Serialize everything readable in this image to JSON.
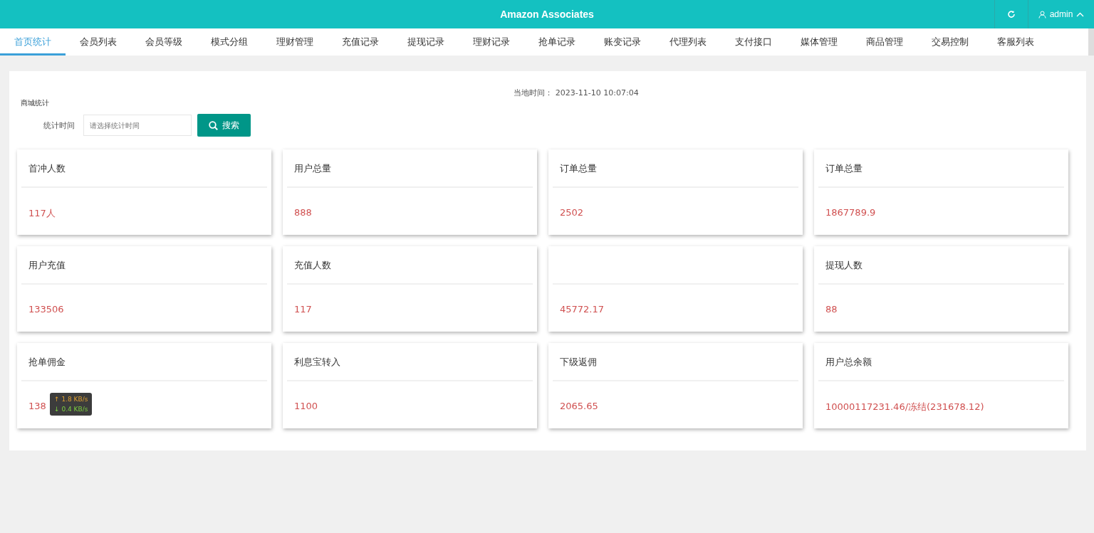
{
  "header": {
    "title": "Amazon Associates",
    "user": "admin"
  },
  "tabs": [
    {
      "label": "首页统计",
      "selected": true
    },
    {
      "label": "会员列表",
      "selected": false
    },
    {
      "label": "会员等级",
      "selected": false
    },
    {
      "label": "模式分组",
      "selected": false
    },
    {
      "label": "理财管理",
      "selected": false
    },
    {
      "label": "充值记录",
      "selected": false
    },
    {
      "label": "提现记录",
      "selected": false
    },
    {
      "label": "理财记录",
      "selected": false
    },
    {
      "label": "抢单记录",
      "selected": false
    },
    {
      "label": "账变记录",
      "selected": false
    },
    {
      "label": "代理列表",
      "selected": false
    },
    {
      "label": "支付接口",
      "selected": false
    },
    {
      "label": "媒体管理",
      "selected": false
    },
    {
      "label": "商品管理",
      "selected": false
    },
    {
      "label": "交易控制",
      "selected": false
    },
    {
      "label": "客服列表",
      "selected": false
    }
  ],
  "local_time": {
    "label": "当地时间：",
    "value": "2023-11-10 10:07:04"
  },
  "section_title": "商城统计",
  "filter": {
    "label": "统计时间",
    "placeholder": "请选择统计时间",
    "button": "搜索"
  },
  "cards": [
    {
      "title": "首冲人数",
      "value": "117人"
    },
    {
      "title": "用户总量",
      "value": "888"
    },
    {
      "title": "订单总量",
      "value": "2502"
    },
    {
      "title": "订单总量",
      "value": "1867789.9"
    },
    {
      "title": "用户充值",
      "value": "133506"
    },
    {
      "title": "充值人数",
      "value": "117"
    },
    {
      "value": "45772.17"
    },
    {
      "title": "提现人数",
      "value": "88"
    },
    {
      "title": "抢单佣金",
      "value": "138"
    },
    {
      "title": "利息宝转入",
      "value": "1100"
    },
    {
      "title": "下级返佣",
      "value": "2065.65"
    },
    {
      "title": "用户总余额",
      "value": "10000117231.46/冻结(231678.12)"
    }
  ],
  "speed_overlay": {
    "upload": "↑ 1.8 KB/s",
    "download": "↓ 0.4 KB/s"
  }
}
